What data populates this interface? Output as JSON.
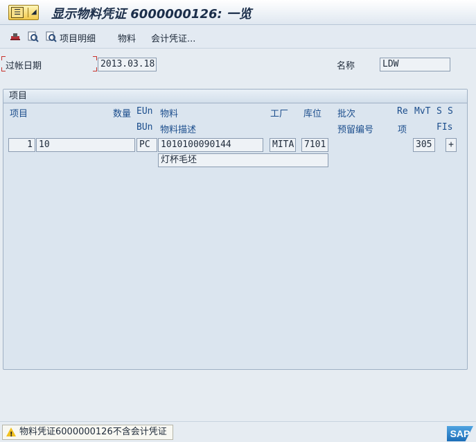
{
  "window": {
    "title": "显示物料凭证 6000000126: 一览"
  },
  "toolbar": {
    "items": [
      {
        "icon": "print-hat-icon"
      },
      {
        "icon": "zoom-icon"
      },
      {
        "icon": "item-details-icon",
        "label": "项目明细"
      },
      {
        "label": "物料"
      },
      {
        "label": "会计凭证..."
      }
    ]
  },
  "header": {
    "posting_date_label": "过帐日期",
    "posting_date_value": "2013.03.18",
    "name_label": "名称",
    "name_value": "LDW"
  },
  "items_group": {
    "title": "项目",
    "columns_row1": {
      "item": "项目",
      "quantity": "数量",
      "eun": "EUn",
      "material": "物料",
      "plant": "工厂",
      "sloc": "库位",
      "batch": "批次",
      "re": "Re",
      "mvt": "MvT",
      "s1": "S",
      "s2": "S"
    },
    "columns_row2": {
      "bun": "BUn",
      "material_desc": "物料描述",
      "reservation": "预留编号",
      "item_short": "项",
      "fis": "FIs"
    },
    "rows": [
      {
        "item": "1",
        "quantity": "10",
        "unit": "PC",
        "material": "1010100090144",
        "plant": "MITA",
        "sloc": "7101",
        "mvt": "305",
        "flag": "+",
        "description": "灯杯毛坯"
      }
    ]
  },
  "status": {
    "message": "物料凭证6000000126不含会计凭证",
    "type_icon": "warning-icon",
    "logo_text": "SAP"
  },
  "colors": {
    "title_text": "#1b2e4a",
    "column_header": "#1b4d8c",
    "required_marker": "#c8322b",
    "warning": "#f0c020"
  }
}
